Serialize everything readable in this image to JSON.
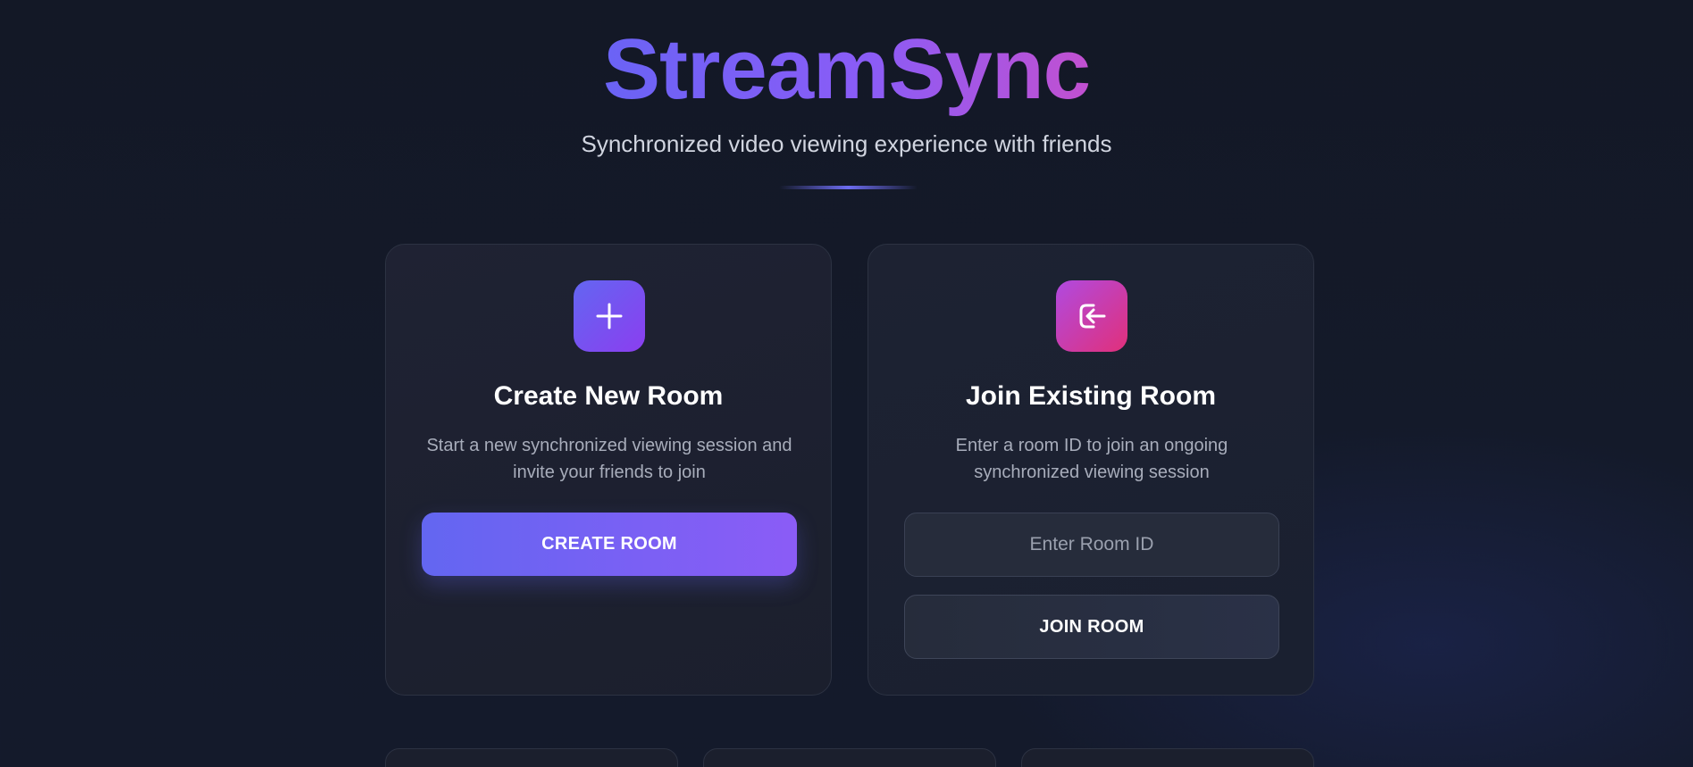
{
  "header": {
    "title": "StreamSync",
    "subtitle": "Synchronized video viewing experience with friends"
  },
  "create_card": {
    "icon": "plus-icon",
    "title": "Create New Room",
    "description": "Start a new synchronized viewing session and invite your friends to join",
    "button_label": "CREATE ROOM"
  },
  "join_card": {
    "icon": "enter-icon",
    "title": "Join Existing Room",
    "description": "Enter a room ID to join an ongoing synchronized viewing session",
    "input_value": "",
    "input_placeholder": "Enter Room ID",
    "button_label": "JOIN ROOM"
  },
  "colors": {
    "background": "#131826",
    "accent_indigo": "#6366f1",
    "accent_violet": "#8b5cf6",
    "accent_pink": "#e1307a",
    "text_muted": "#a8adbb"
  }
}
